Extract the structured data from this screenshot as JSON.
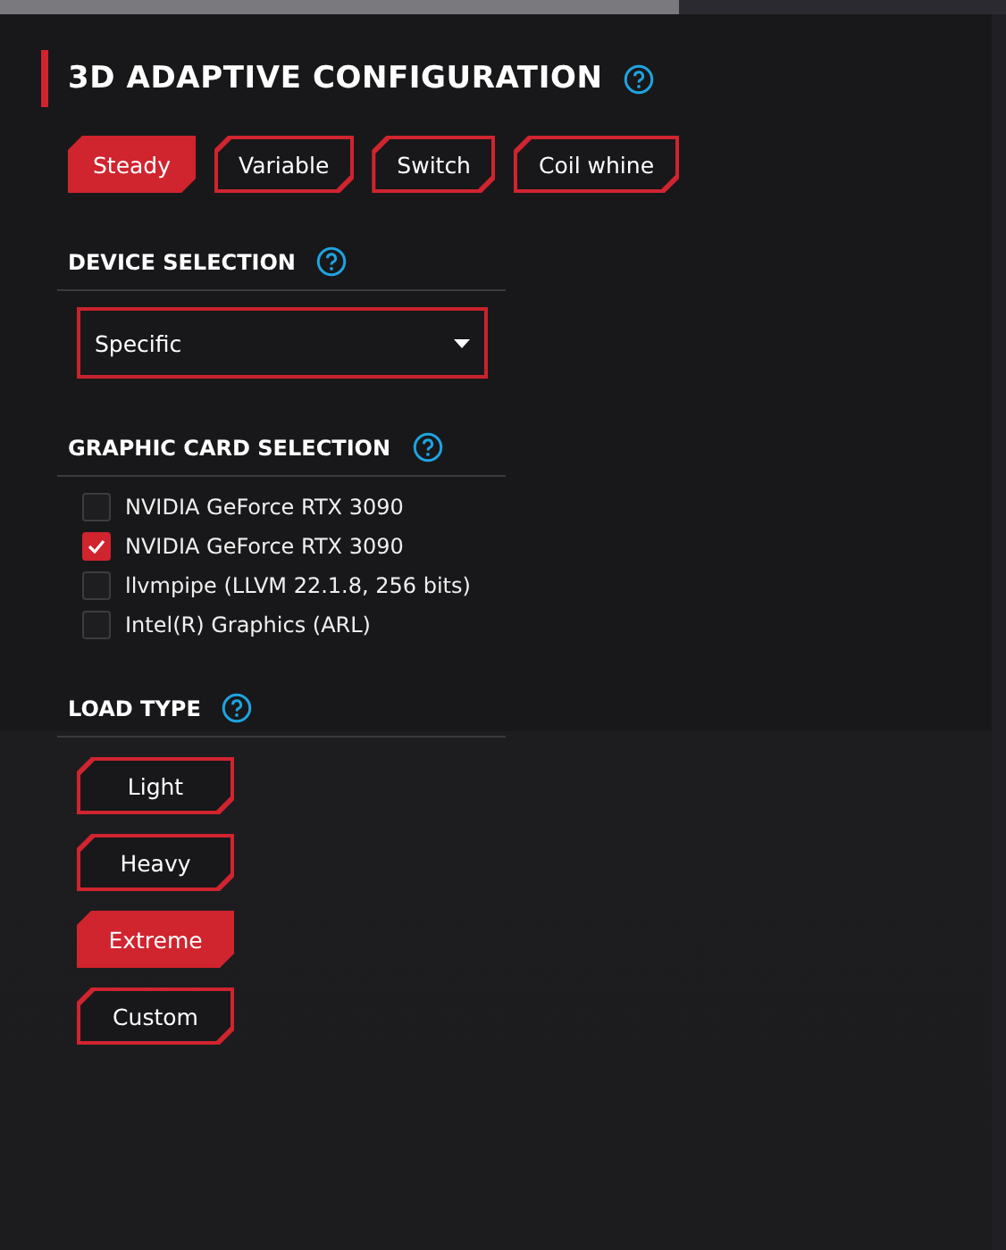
{
  "title": "3D ADAPTIVE CONFIGURATION",
  "modes": [
    {
      "label": "Steady",
      "selected": true
    },
    {
      "label": "Variable",
      "selected": false
    },
    {
      "label": "Switch",
      "selected": false
    },
    {
      "label": "Coil whine",
      "selected": false
    }
  ],
  "device_selection": {
    "heading": "DEVICE SELECTION",
    "value": "Specific"
  },
  "graphic_card_selection": {
    "heading": "GRAPHIC CARD SELECTION",
    "cards": [
      {
        "label": "NVIDIA GeForce RTX 3090",
        "checked": false
      },
      {
        "label": "NVIDIA GeForce RTX 3090",
        "checked": true
      },
      {
        "label": "llvmpipe (LLVM 22.1.8, 256 bits)",
        "checked": false
      },
      {
        "label": "Intel(R) Graphics (ARL)",
        "checked": false
      }
    ]
  },
  "load_type": {
    "heading": "LOAD TYPE",
    "options": [
      {
        "label": "Light",
        "selected": false
      },
      {
        "label": "Heavy",
        "selected": false
      },
      {
        "label": "Extreme",
        "selected": true
      },
      {
        "label": "Custom",
        "selected": false
      }
    ]
  }
}
